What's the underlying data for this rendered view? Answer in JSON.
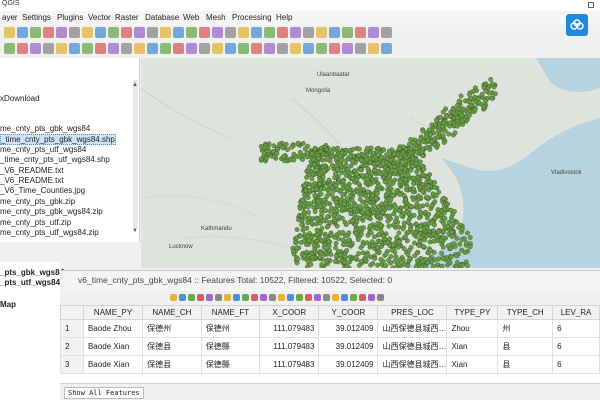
{
  "window": {
    "title": "QGIS"
  },
  "menu": [
    "ayer",
    "Settings",
    "Plugins",
    "Vector",
    "Raster",
    "Database",
    "Web",
    "Mesh",
    "Processing",
    "Help"
  ],
  "browser": {
    "items": [
      "xDownload",
      "me_cnty_pts_gbk_wgs84",
      "_time_cnty_pts_gbk_wgs84.shp",
      "me_cnty_pts_utf_wgs84",
      "_time_cnty_pts_utf_wgs84.shp",
      "_V6_README.txt",
      "_V6_README.txt",
      "_V6_Time_Counties.jpg",
      "me_cnty_pts_gbk.zip",
      "me_cnty_pts_gbk_wgs84.zip",
      "me_cnty_pts_utf.zip",
      "me_cnty_pts_utf_wgs84.zip"
    ]
  },
  "layers": {
    "items": [
      "_pts_gbk_wgs84",
      "_pts_utf_wgs84",
      "Map"
    ]
  },
  "map_labels": [
    "Vladivostok",
    "Mongolia",
    "Lucknow",
    "Kathmandu",
    "Ulaanbaatar"
  ],
  "attribute_table": {
    "title": "v6_time_cnty_pts_gbk_wgs84 :: Features Total: 10522, Filtered: 10522, Selected: 0",
    "columns": [
      "NAME_PY",
      "NAME_CH",
      "NAME_FT",
      "X_COOR",
      "Y_COOR",
      "PRES_LOC",
      "TYPE_PY",
      "TYPE_CH",
      "LEV_RA"
    ],
    "rows": [
      {
        "idx": "1",
        "cells": [
          "Baode Zhou",
          "保德州",
          "保德州",
          "111.079483",
          "39.012409",
          "山西保德县城西…",
          "Zhou",
          "州",
          "6"
        ]
      },
      {
        "idx": "2",
        "cells": [
          "Baode Xian",
          "保德县",
          "保德縣",
          "111.079483",
          "39.012409",
          "山西保德县城西…",
          "Xian",
          "县",
          "6"
        ]
      },
      {
        "idx": "3",
        "cells": [
          "Baode Xian",
          "保德县",
          "保德縣",
          "111.079483",
          "39.012409",
          "山西保德县城西…",
          "Xian",
          "县",
          "6"
        ]
      }
    ],
    "show_all": "Show All Features"
  },
  "colors": {
    "points": "#6a9c46",
    "point_border": "#2d4a1f",
    "map_bg": "#dfe3dd",
    "accent": "#1e88e5"
  }
}
